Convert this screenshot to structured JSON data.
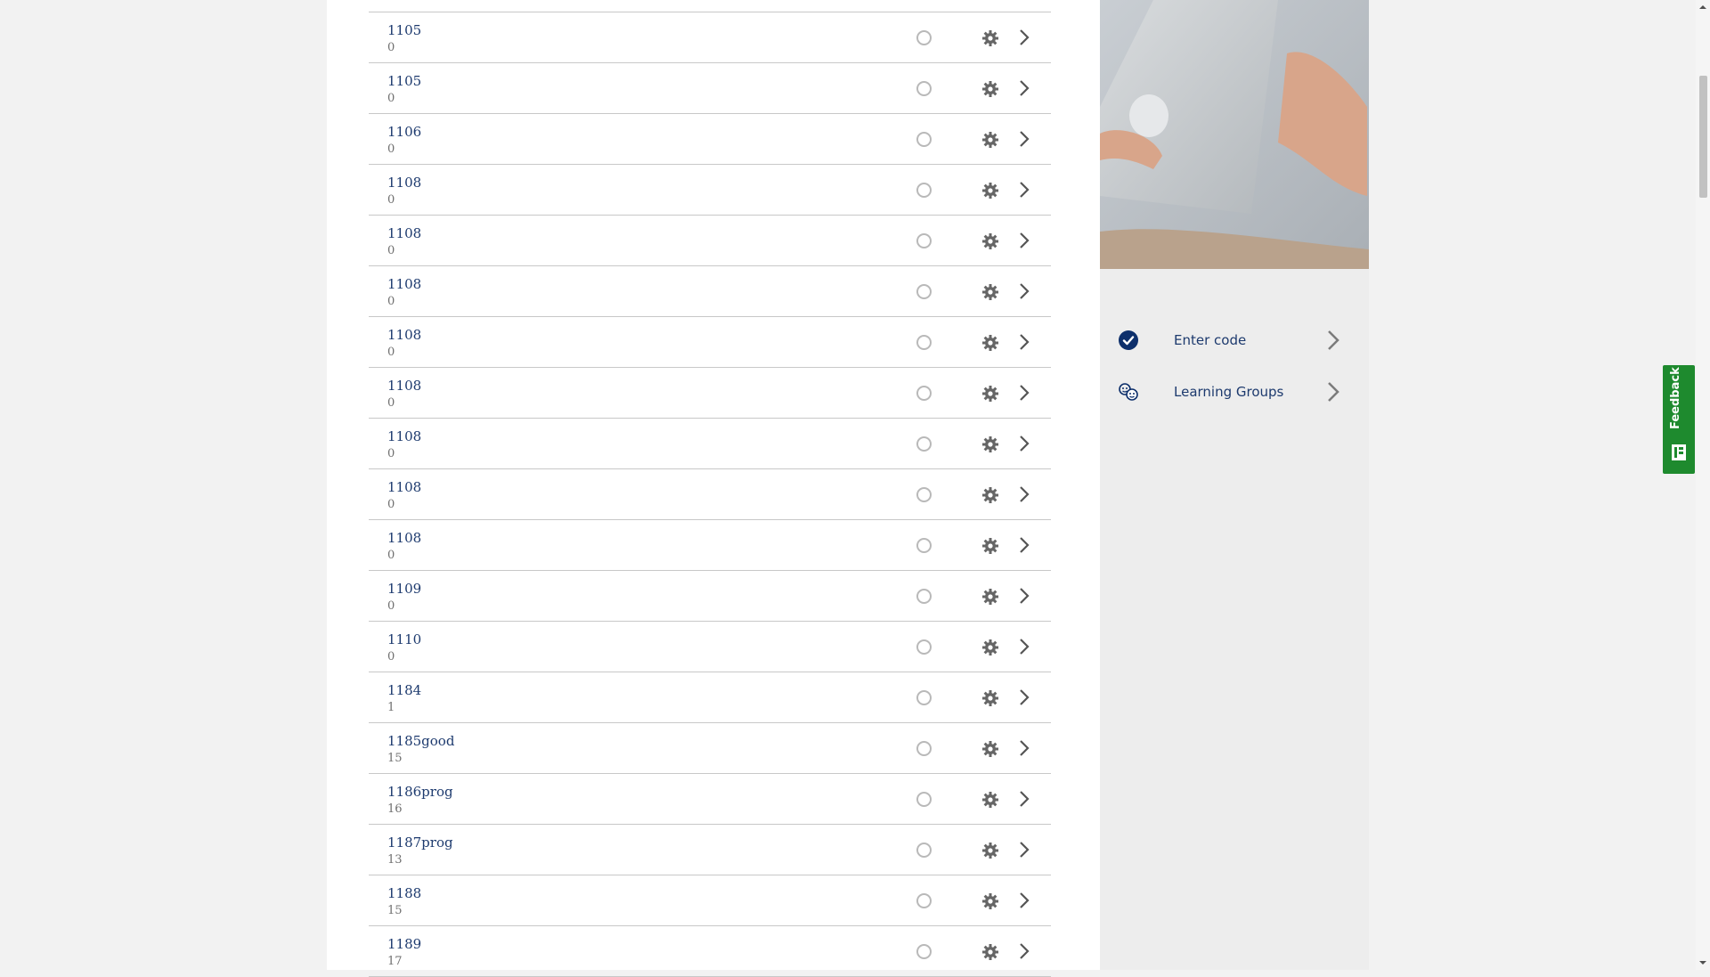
{
  "list": {
    "rows": [
      {
        "title": "1105",
        "count": "0"
      },
      {
        "title": "1105",
        "count": "0"
      },
      {
        "title": "1106",
        "count": "0"
      },
      {
        "title": "1108",
        "count": "0"
      },
      {
        "title": "1108",
        "count": "0"
      },
      {
        "title": "1108",
        "count": "0"
      },
      {
        "title": "1108",
        "count": "0"
      },
      {
        "title": "1108",
        "count": "0"
      },
      {
        "title": "1108",
        "count": "0"
      },
      {
        "title": "1108",
        "count": "0"
      },
      {
        "title": "1108",
        "count": "0"
      },
      {
        "title": "1109",
        "count": "0"
      },
      {
        "title": "1110",
        "count": "0"
      },
      {
        "title": "1184",
        "count": "1"
      },
      {
        "title": "1185good",
        "count": "15"
      },
      {
        "title": "1186prog",
        "count": "16"
      },
      {
        "title": "1187prog",
        "count": "13"
      },
      {
        "title": "1188",
        "count": "15"
      },
      {
        "title": "1189",
        "count": "17"
      }
    ],
    "row_icons": [
      "radio-icon",
      "gear-icon",
      "chevron-right-icon"
    ]
  },
  "sidebar": {
    "links": [
      {
        "label": "Enter code",
        "icon": "check-circle-icon"
      },
      {
        "label": "Learning Groups",
        "icon": "group-faces-icon"
      }
    ]
  },
  "feedback": {
    "label": "Feedback",
    "icon": "form-icon"
  },
  "colors": {
    "link_text": "#1d3a6e",
    "muted_text": "#6f6f6f",
    "feedback_bg": "#1e8a2e",
    "check_icon": "#0d2f6b",
    "page_bg": "#f2f2f2",
    "sidebar_bg": "#ededed"
  }
}
